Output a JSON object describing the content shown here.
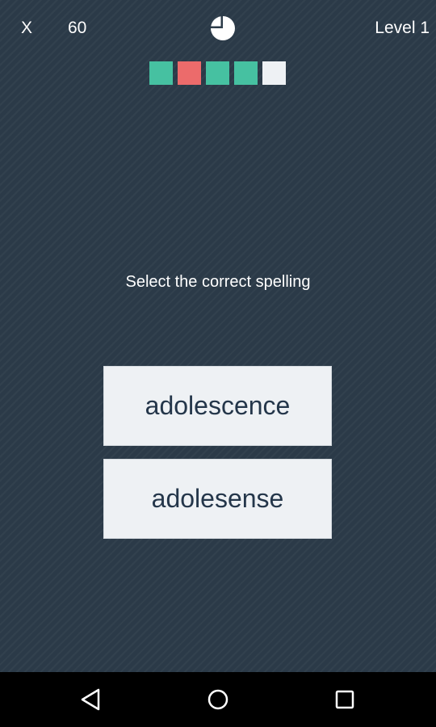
{
  "header": {
    "close_label": "X",
    "timer_value": "60",
    "level_label": "Level 1"
  },
  "progress": {
    "squares": [
      {
        "state": "correct",
        "color": "#46c1a1"
      },
      {
        "state": "wrong",
        "color": "#ec6b6b"
      },
      {
        "state": "correct",
        "color": "#46c1a1"
      },
      {
        "state": "correct",
        "color": "#46c1a1"
      },
      {
        "state": "current",
        "color": "#eef1f4"
      }
    ]
  },
  "question": {
    "prompt": "Select the correct spelling"
  },
  "answers": [
    {
      "label": "adolescence"
    },
    {
      "label": "adolesense"
    }
  ],
  "colors": {
    "background": "#2b3a48",
    "button_bg": "#eef1f4",
    "button_text": "#24364a",
    "correct": "#46c1a1",
    "wrong": "#ec6b6b"
  },
  "icons": {
    "timer": "pie-timer-icon",
    "nav_back": "back-triangle-icon",
    "nav_home": "home-circle-icon",
    "nav_recents": "recents-square-icon"
  }
}
